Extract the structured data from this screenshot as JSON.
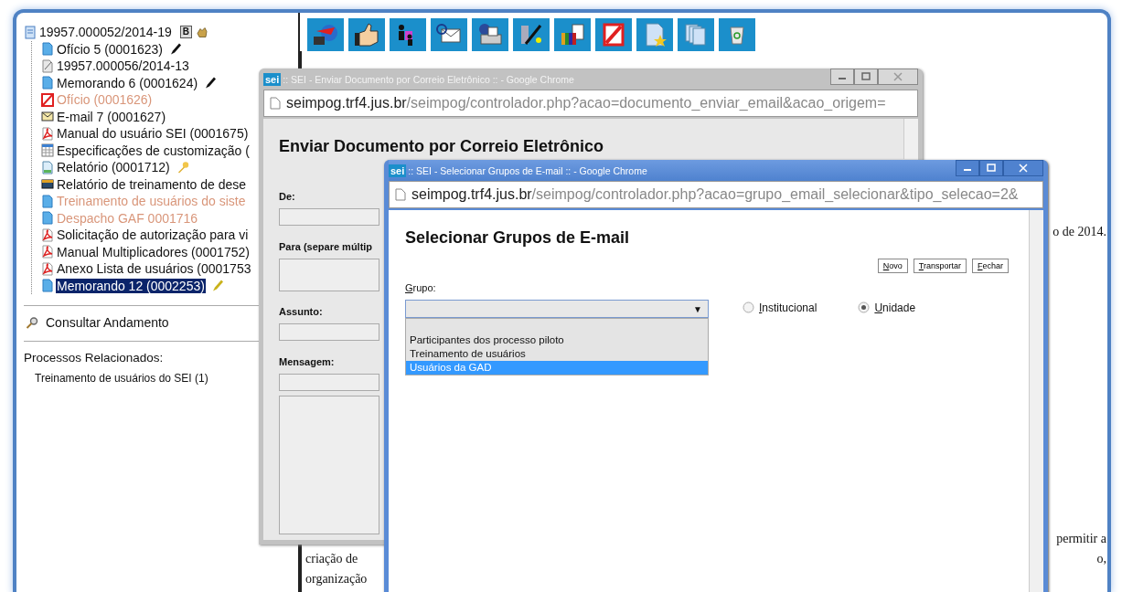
{
  "tree": {
    "label": "19957.000052/2014-19",
    "badge": "B",
    "children": [
      {
        "label": "Ofício 5 (0001623)",
        "kind": "document",
        "muted": false,
        "selected": false,
        "signed": true,
        "restricted": false
      },
      {
        "label": "19957.000056/2014-13",
        "kind": "process",
        "muted": false,
        "selected": false,
        "signed": false,
        "restricted": false
      },
      {
        "label": "Memorando 6 (0001624)",
        "kind": "document",
        "muted": false,
        "selected": false,
        "signed": true,
        "restricted": false
      },
      {
        "label": "Ofício (0001626)",
        "kind": "cancelled",
        "muted": true,
        "selected": false,
        "signed": false,
        "restricted": false
      },
      {
        "label": "E-mail 7 (0001627)",
        "kind": "email",
        "muted": false,
        "selected": false,
        "signed": false,
        "restricted": false
      },
      {
        "label": "Manual do usuário SEI (0001675)",
        "kind": "pdf",
        "muted": false,
        "selected": false,
        "signed": false,
        "restricted": false
      },
      {
        "label": "Especificações de customização (",
        "kind": "spreadsheet",
        "muted": false,
        "selected": false,
        "signed": false,
        "restricted": false
      },
      {
        "label": "Relatório (0001712)",
        "kind": "report",
        "muted": false,
        "selected": false,
        "signed": false,
        "restricted": true
      },
      {
        "label": "Relatório de treinamento de dese",
        "kind": "scan",
        "muted": false,
        "selected": false,
        "signed": false,
        "restricted": false
      },
      {
        "label": "Treinamento de usuários do siste",
        "kind": "document",
        "muted": true,
        "selected": false,
        "signed": false,
        "restricted": false
      },
      {
        "label": "Despacho GAF 0001716",
        "kind": "document",
        "muted": true,
        "selected": false,
        "signed": false,
        "restricted": false
      },
      {
        "label": "Solicitação de autorização para vi",
        "kind": "pdf",
        "muted": false,
        "selected": false,
        "signed": false,
        "restricted": false
      },
      {
        "label": "Manual Multiplicadores (0001752)",
        "kind": "pdf",
        "muted": false,
        "selected": false,
        "signed": false,
        "restricted": false
      },
      {
        "label": "Anexo Lista de usuários (0001753",
        "kind": "pdf",
        "muted": false,
        "selected": false,
        "signed": false,
        "restricted": false
      },
      {
        "label": "Memorando 12 (0002253)",
        "kind": "document",
        "muted": false,
        "selected": true,
        "signed": true,
        "restricted": false
      }
    ]
  },
  "consult_link": "Consultar Andamento",
  "related": {
    "title": "Processos Relacionados:",
    "items": [
      "Treinamento de usuários do SEI (1)"
    ]
  },
  "document_fragments": {
    "top_right": "o de 2014.",
    "lines": [
      {
        "right": "permitir a"
      },
      {
        "left": "criação de",
        "right": "o,"
      },
      {
        "left": "organização"
      }
    ]
  },
  "email_window": {
    "logo": "sei",
    "title": ":: SEI - Enviar Documento por Correio Eletrônico :: - Google Chrome",
    "host": "seimpog.trf4.jus.br",
    "path": "/seimpog/controlador.php?acao=documento_enviar_email&acao_origem=",
    "heading": "Enviar Documento por Correio Eletrônico",
    "fields": [
      {
        "label": "De:",
        "kind": "input"
      },
      {
        "label": "Para (separe múltip",
        "kind": "textarea"
      },
      {
        "label": "Assunto:",
        "kind": "input"
      },
      {
        "label": "Mensagem:",
        "kind": "message"
      }
    ]
  },
  "group_window": {
    "logo": "sei",
    "title": ":: SEI - Selecionar Grupos de E-mail :: - Google Chrome",
    "host": "seimpog.trf4.jus.br",
    "path": "/seimpog/controlador.php?acao=grupo_email_selecionar&tipo_selecao=2&",
    "heading": "Selecionar Grupos de E-mail",
    "buttons": [
      "Novo",
      "Transportar",
      "Fechar"
    ],
    "select": {
      "label": "Grupo:",
      "arrow": "▼",
      "options": [
        {
          "label": "Participantes dos processo piloto",
          "selected": false
        },
        {
          "label": "Treinamento de usuários",
          "selected": false
        },
        {
          "label": "Usuários da GAD",
          "selected": true
        }
      ]
    },
    "radios": [
      {
        "label": "Institucional",
        "selected": false
      },
      {
        "label": "Unidade",
        "selected": true
      }
    ]
  }
}
